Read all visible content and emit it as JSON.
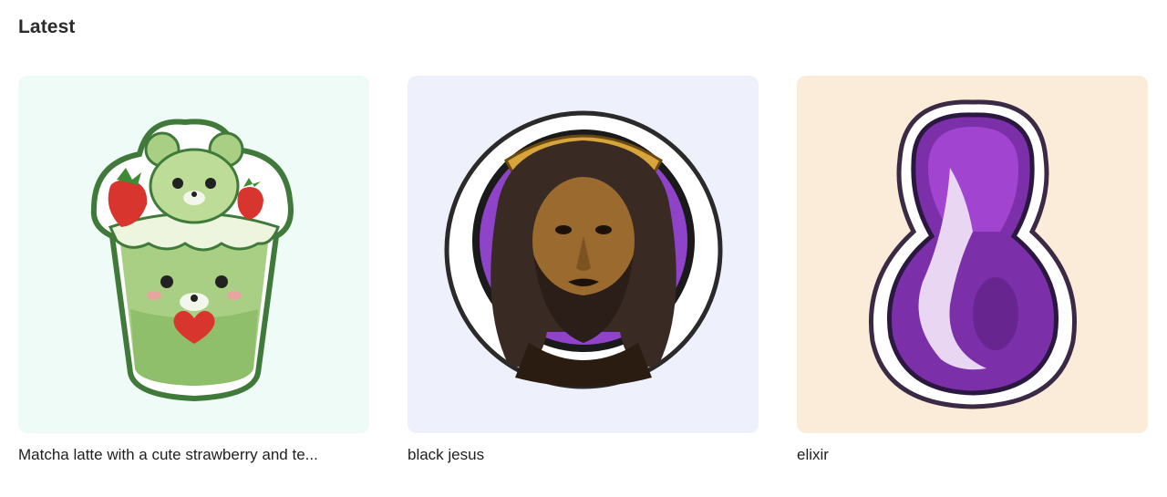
{
  "section": {
    "title": "Latest"
  },
  "cards": [
    {
      "caption": "Matcha latte with a cute strawberry and te...",
      "background": "#effbf6",
      "image_icon": "matcha-bear-cup-sticker"
    },
    {
      "caption": "black jesus",
      "background": "#eef1fb",
      "image_icon": "portrait-halo-sticker"
    },
    {
      "caption": "elixir",
      "background": "#fbecd9",
      "image_icon": "purple-drop-sticker"
    }
  ]
}
